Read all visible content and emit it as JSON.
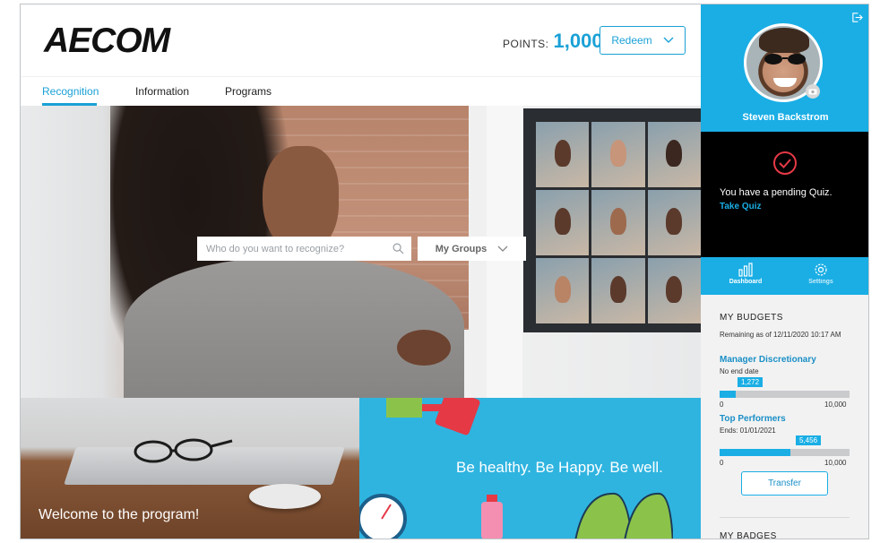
{
  "header": {
    "logo": "AECOM",
    "points_label": "POINTS:",
    "points_value": "1,000",
    "redeem_label": "Redeem"
  },
  "nav": {
    "items": [
      {
        "label": "Recognition",
        "active": true
      },
      {
        "label": "Information",
        "active": false
      },
      {
        "label": "Programs",
        "active": false
      }
    ]
  },
  "hero": {
    "search_placeholder": "Who do you want to recognize?",
    "groups_label": "My Groups"
  },
  "tiles": {
    "welcome": "Welcome to the program!",
    "health": "Be healthy. Be Happy. Be well."
  },
  "sidebar": {
    "user_name": "Steven Backstrom",
    "quiz_message": "You have a pending Quiz.",
    "quiz_link": "Take Quiz",
    "tabs": [
      {
        "label": "Dashboard",
        "icon": "bar-chart-icon"
      },
      {
        "label": "Settings",
        "icon": "gear-icon"
      }
    ],
    "budgets_title": "MY BUDGETS",
    "remaining": "Remaining as of 12/11/2020 10:17 AM",
    "budgets": [
      {
        "name": "Manager Discretionary",
        "sub": "No end date",
        "value_label": "1,272",
        "min": "0",
        "max": "10,000",
        "fraction": 0.127
      },
      {
        "name": "Top Performers",
        "sub": "Ends: 01/01/2021",
        "value_label": "5,456",
        "min": "0",
        "max": "10,000",
        "fraction": 0.5456
      }
    ],
    "transfer_label": "Transfer",
    "badges_title": "MY BADGES"
  },
  "colors": {
    "accent": "#1aaee5",
    "link": "#1a8fc6",
    "quiz_bg": "#000000"
  }
}
